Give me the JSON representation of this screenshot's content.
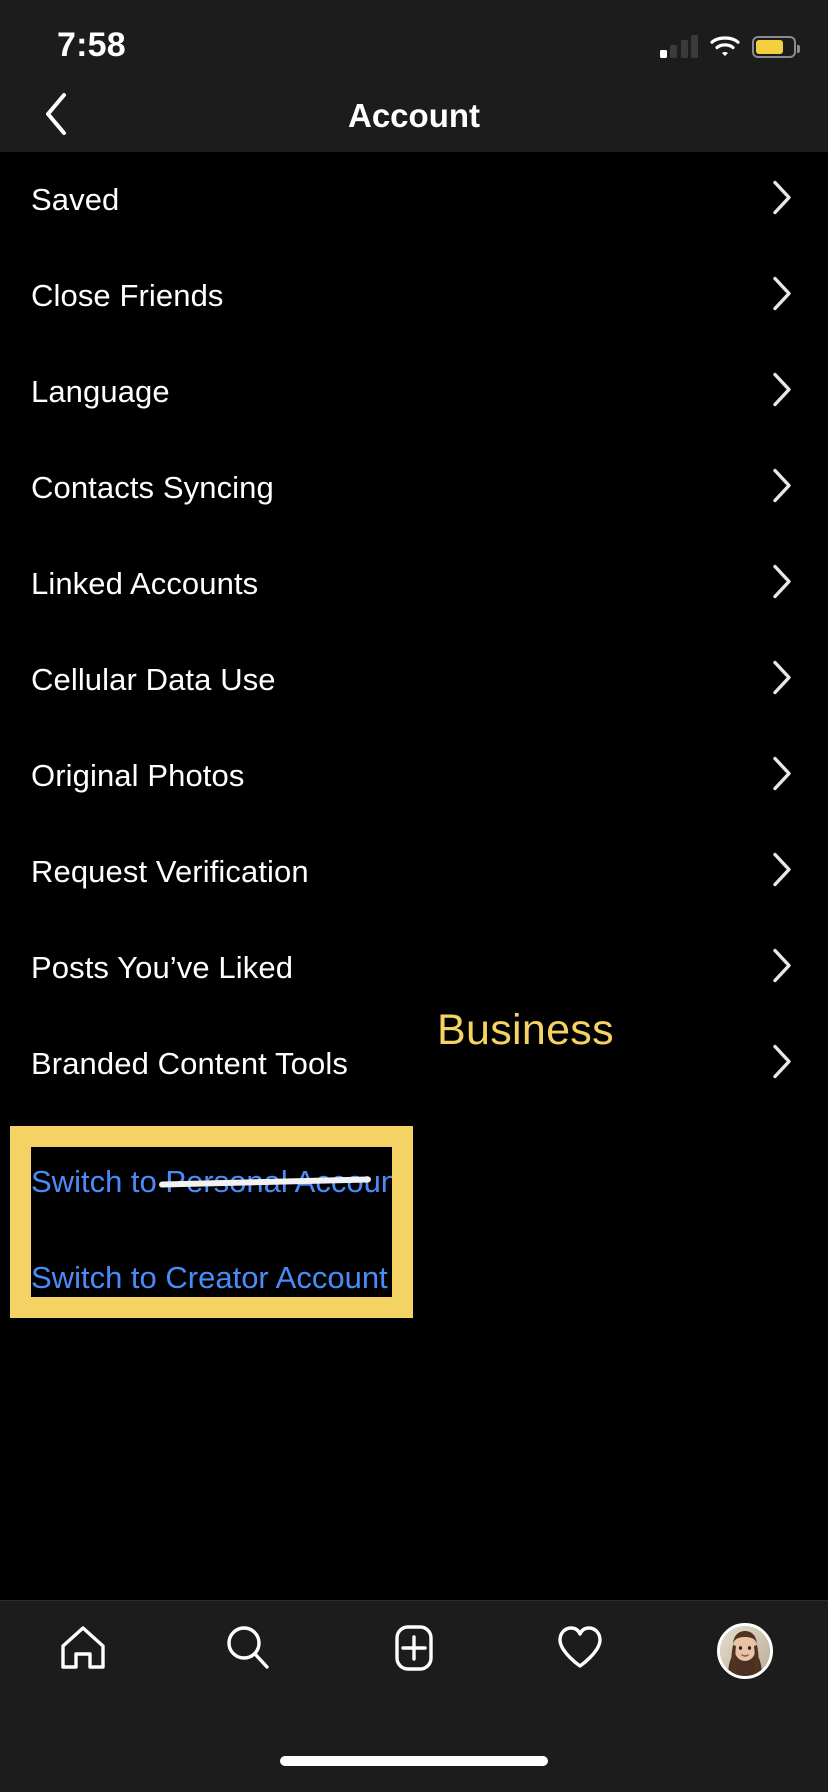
{
  "status_bar": {
    "time": "7:58",
    "cellular_icon": "cellular-signal-icon",
    "cellular_bars_total": 4,
    "cellular_bars_active": 1,
    "wifi_icon": "wifi-icon",
    "battery_icon": "battery-icon",
    "battery_level_percent": 76,
    "battery_color": "#F4D03F"
  },
  "header": {
    "title": "Account",
    "back_icon": "chevron-left-icon"
  },
  "list": {
    "chevron_icon": "chevron-right-icon",
    "items": [
      {
        "label": "Saved"
      },
      {
        "label": "Close Friends"
      },
      {
        "label": "Language"
      },
      {
        "label": "Contacts Syncing"
      },
      {
        "label": "Linked Accounts"
      },
      {
        "label": "Cellular Data Use"
      },
      {
        "label": "Original Photos"
      },
      {
        "label": "Request Verification"
      },
      {
        "label": "Posts You’ve Liked"
      },
      {
        "label": "Branded Content Tools"
      }
    ]
  },
  "switch_actions": {
    "link_color": "#4a8cf7",
    "personal": {
      "prefix": "Switch to ",
      "struck_word": "Personal",
      "suffix": " Account",
      "strikethrough": true,
      "strike_color": "#f2f2f2"
    },
    "creator": {
      "label": "Switch to Creator Account"
    }
  },
  "annotation": {
    "box_color": "#F5D264",
    "note_text": "Business"
  },
  "tab_bar": {
    "items": [
      {
        "name": "home-icon",
        "label": "Home"
      },
      {
        "name": "search-icon",
        "label": "Search"
      },
      {
        "name": "add-post-icon",
        "label": "New Post"
      },
      {
        "name": "heart-icon",
        "label": "Activity"
      },
      {
        "name": "profile-avatar",
        "label": "Profile"
      }
    ]
  }
}
